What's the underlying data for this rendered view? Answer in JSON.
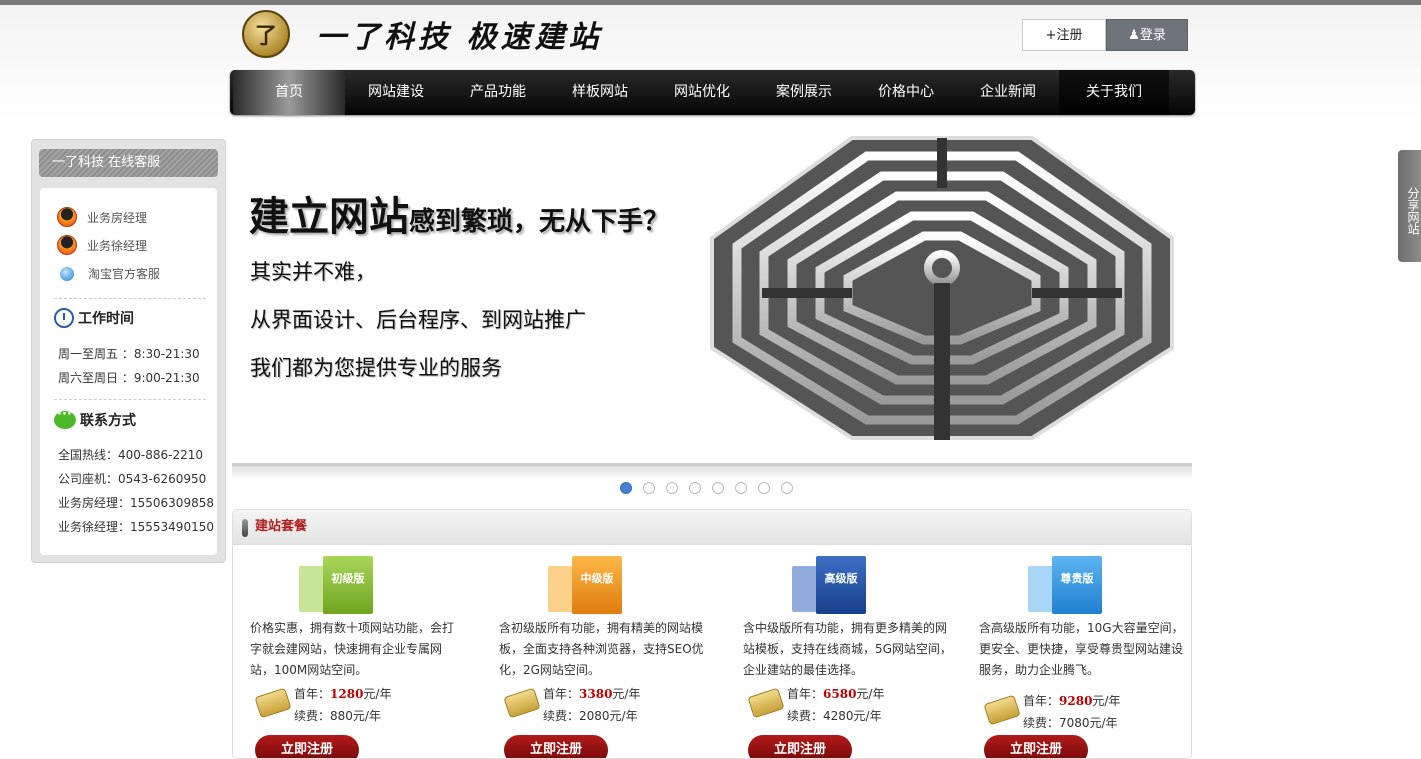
{
  "header": {
    "logo_mark": "了",
    "logo_text": "一了科技 极速建站",
    "register_label": "注册",
    "login_label": "登录"
  },
  "nav": {
    "items": [
      "首页",
      "网站建设",
      "产品功能",
      "样板网站",
      "网站优化",
      "案例展示",
      "价格中心",
      "企业新闻",
      "关于我们"
    ],
    "active_index": 0
  },
  "sidebar": {
    "title": "一了科技 在线客服",
    "service": [
      "业务房经理",
      "业务徐经理",
      "淘宝官方客服"
    ],
    "work_time": {
      "title": "工作时间",
      "lines": [
        "周一至周五 ：8:30-21:30",
        "周六至周日 ：9:00-21:30"
      ]
    },
    "contact": {
      "title": "联系方式",
      "lines": [
        "全国热线：400-886-2210",
        "公司座机：0543-6260950",
        "业务房经理：15506309858",
        "业务徐经理：15553490150"
      ]
    }
  },
  "banner": {
    "headline_main": "建立网站",
    "headline_sub": "感到繁琐，无从下手？",
    "lines": [
      "其实并不难，",
      "从界面设计、后台程序、到网站推广",
      "我们都为您提供专业的服务"
    ],
    "slide_count": 8,
    "active_slide": 0
  },
  "packages": {
    "title": "建站套餐",
    "items": [
      {
        "name": "初级版",
        "desc": "价格实惠，拥有数十项网站功能，会打字就会建网站，快速拥有企业专属网站，100M网站空间。",
        "first_year_label": "首年：",
        "first_year_price": "1280",
        "renew_label": "续费：",
        "renew_price": "880元/年",
        "unit": "元/年",
        "color": "#8cc63f",
        "button": "立即注册"
      },
      {
        "name": "中级版",
        "desc": "含初级版所有功能，拥有精美的网站模板，全面支持各种浏览器，支持SEO优化，2G网站空间。",
        "first_year_label": "首年：",
        "first_year_price": "3380",
        "renew_label": "续费：",
        "renew_price": "2080元/年",
        "unit": "元/年",
        "color": "#f39a1e",
        "button": "立即注册"
      },
      {
        "name": "高级版",
        "desc": "含中级版所有功能，拥有更多精美的网站模板，支持在线商城，5G网站空间，企业建站的最佳选择。",
        "first_year_label": "首年：",
        "first_year_price": "6580",
        "renew_label": "续费：",
        "renew_price": "4280元/年",
        "unit": "元/年",
        "color": "#1e4fa8",
        "button": "立即注册"
      },
      {
        "name": "尊贵版",
        "desc": "含高级版所有功能，10G大容量空间，更安全、更快捷，享受尊贵型网站建设服务，助力企业腾飞。",
        "first_year_label": "首年：",
        "first_year_price": "9280",
        "renew_label": "续费：",
        "renew_price": "7080元/年",
        "unit": "元/年",
        "color": "#2a8ee0",
        "button": "立即注册"
      }
    ]
  },
  "share": {
    "label": "分享网站"
  }
}
